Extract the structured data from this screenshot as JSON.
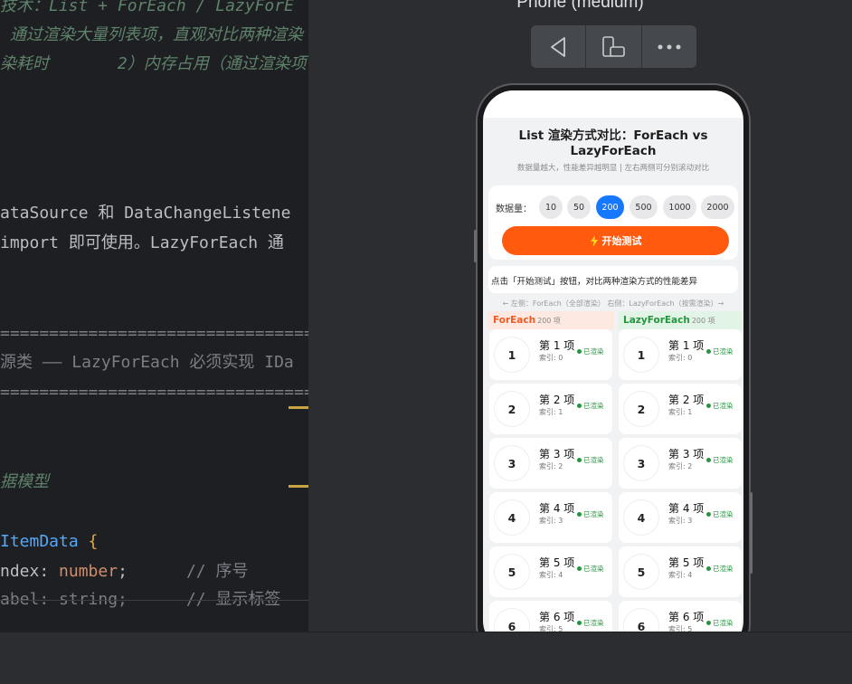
{
  "editor": {
    "lines": [
      {
        "text": "技术：List + ForEach / LazyForE",
        "cls": "c-comment"
      },
      {
        "text": " 通过渲染大量列表项，直观对比两种渲染",
        "cls": "c-comment"
      },
      {
        "text": "染耗时       2）内存占用（通过渲染项",
        "cls": "c-comment"
      },
      {
        "text": "ataSource 和 DataChangeListene",
        "cls": "c-plain"
      },
      {
        "text": "import 即可使用。LazyForEach 通",
        "cls": "c-plain"
      },
      {
        "text": "====================================",
        "cls": "c-sep"
      },
      {
        "text": "源类 —— LazyForEach 必须实现 IDa",
        "cls": "c-sep"
      },
      {
        "text": "====================================",
        "cls": "c-sep"
      },
      {
        "text": "据模型",
        "cls": "c-comment"
      },
      {
        "text": "ndex",
        "cls": "c-plain"
      },
      {
        "text": "number",
        "cls": "c-kw"
      },
      {
        "text": ";      ",
        "cls": "c-plain"
      },
      {
        "text": "// 序号",
        "cls": "c-gray"
      },
      {
        "text": "ItemData",
        "cls": "c-type"
      },
      {
        "text": "{",
        "cls": "c-brace"
      },
      {
        "text": "abel: string;      // 显示标签",
        "cls": "c-plain"
      }
    ]
  },
  "previewer": {
    "device_title": "Phone (medium)",
    "toolbar": [
      "back-icon",
      "rotate-device-icon",
      "more-icon"
    ]
  },
  "app": {
    "title": "List 渲染方式对比：ForEach vs LazyForEach",
    "subtitle": "数据量越大，性能差异越明显 | 左右两侧可分别滚动对比",
    "count_label": "数据量：",
    "counts": [
      "10",
      "50",
      "200",
      "500",
      "1000",
      "2000"
    ],
    "selected_count": "200",
    "start_label": "开始测试",
    "hint": "点击「开始测试」按钮，对比两种渲染方式的性能差异",
    "legend": "← 左侧：ForEach（全部渲染） 右侧：LazyForEach（按需渲染）→",
    "foreach": {
      "name": "ForEach",
      "count": "200 项"
    },
    "lazyforeach": {
      "name": "LazyForEach",
      "count": "200 项"
    },
    "items": [
      {
        "num": "1",
        "title": "第 1 项",
        "idx": "索引: 0",
        "status": "已渲染"
      },
      {
        "num": "2",
        "title": "第 2 项",
        "idx": "索引: 1",
        "status": "已渲染"
      },
      {
        "num": "3",
        "title": "第 3 项",
        "idx": "索引: 2",
        "status": "已渲染"
      },
      {
        "num": "4",
        "title": "第 4 项",
        "idx": "索引: 3",
        "status": "已渲染"
      },
      {
        "num": "5",
        "title": "第 5 项",
        "idx": "索引: 4",
        "status": "已渲染"
      },
      {
        "num": "6",
        "title": "第 6 项",
        "idx": "索引: 5",
        "status": "已渲染"
      }
    ]
  },
  "colors": {
    "accent_blue": "#1677ff",
    "start_orange": "#ff5a0d",
    "foreach_orange": "#ef5b26",
    "lazy_green": "#23963d"
  }
}
